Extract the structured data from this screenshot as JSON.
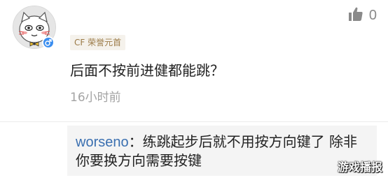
{
  "comment": {
    "rank_badge": "CF 荣誉元首",
    "text": "后面不按前进健都能跳？",
    "timestamp": "16小时前",
    "like_count": "0",
    "icons": {
      "avatar": "cartoon-cat-avatar",
      "gender": "male-gender-icon",
      "like": "thumbs-up-icon"
    }
  },
  "reply": {
    "username": "worseno",
    "colon": "：",
    "text": "练跳起步后就不用按方向键了 除非你要换方向需要按键"
  },
  "watermark": "游戏播报",
  "colors": {
    "username_link": "#3a6fb0",
    "badge_text": "#9b7a46",
    "badge_bg": "#f5f2ec",
    "gender_badge": "#3b8ef0",
    "reply_bg": "#f4f4f4"
  }
}
